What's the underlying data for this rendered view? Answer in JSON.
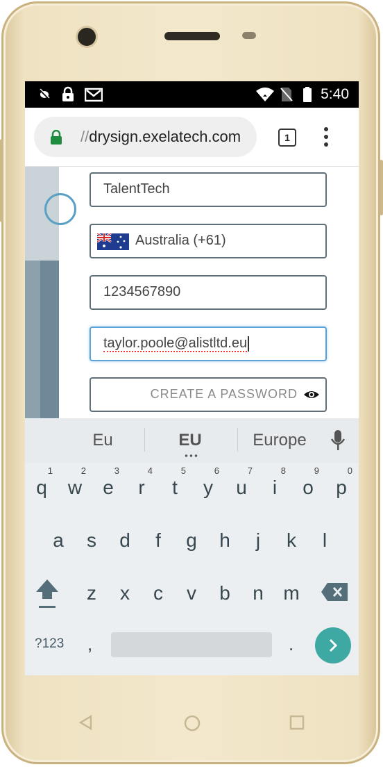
{
  "status_bar": {
    "time": "5:40",
    "icons": [
      "silent-mode-icon",
      "lock-icon",
      "gmail-icon",
      "wifi-icon",
      "no-sim-icon",
      "battery-icon"
    ]
  },
  "browser": {
    "url_prefix": "//",
    "url_host": "drysign.exelatech.com",
    "tab_count": "1",
    "icons": [
      "secure-lock-icon",
      "tab-switcher-icon",
      "overflow-menu-icon"
    ]
  },
  "form": {
    "company": "TalentTech",
    "country": "Australia (+61)",
    "phone": "1234567890",
    "email": "taylor.poole@alistltd.eu",
    "password_placeholder": "CREATE A PASSWORD",
    "icons": [
      "australia-flag-icon",
      "show-password-eye-icon"
    ]
  },
  "keyboard": {
    "suggestions": [
      "Eu",
      "EU",
      "Europe"
    ],
    "row1": [
      "q",
      "w",
      "e",
      "r",
      "t",
      "y",
      "u",
      "i",
      "o",
      "p"
    ],
    "row1_hints": [
      "1",
      "2",
      "3",
      "4",
      "5",
      "6",
      "7",
      "8",
      "9",
      "0"
    ],
    "row2": [
      "a",
      "s",
      "d",
      "f",
      "g",
      "h",
      "j",
      "k",
      "l"
    ],
    "row3": [
      "z",
      "x",
      "c",
      "v",
      "b",
      "n",
      "m"
    ],
    "symbols_key": "?123",
    "comma_key": ",",
    "period_key": ".",
    "colors": {
      "enter": "#3ea8a3",
      "key_text": "#37474f",
      "background": "#eceff1"
    }
  },
  "device": {
    "body_color": "#f3e8cc"
  }
}
